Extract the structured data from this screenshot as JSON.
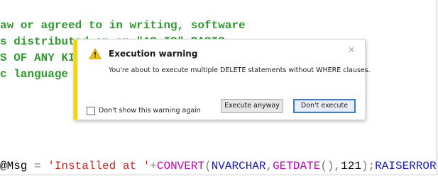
{
  "editor": {
    "lines": [
      "aw or agreed to in writing, software",
      "s distributed on an \"AS IS\" BASIS,",
      "S OF ANY KIND, either express or",
      "c language governing permissions"
    ],
    "sql": {
      "ident_msg": "@Msg",
      "eq": " = ",
      "str": "'Installed at '",
      "plus": "+",
      "fn_convert": "CONVERT",
      "paren_open": "(",
      "kw_nvarchar": "NVARCHAR",
      "comma1": ",",
      "fn_getdate": "GETDATE",
      "paren_pair": "()",
      "comma2": ",",
      "num": "121",
      "end": ");",
      "kw_raiserror": "RAISERROR"
    }
  },
  "dialog": {
    "title": "Execution warning",
    "message": "You're about to execute multiple DELETE statements without WHERE clauses.",
    "close_glyph": "×",
    "checkbox_label": "Don't show this warning again",
    "checkbox_checked": false,
    "execute_button_label": "Execute anyway",
    "dont_execute_button_label": "Don't execute",
    "icon": "warning-triangle",
    "accent_color": "#f3d21a"
  }
}
